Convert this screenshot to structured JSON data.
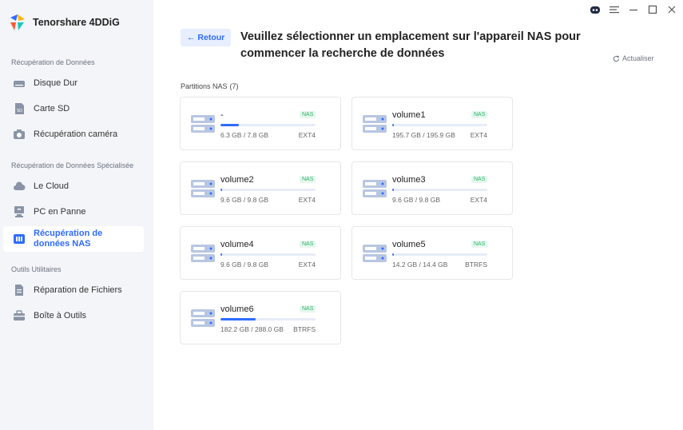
{
  "app": {
    "name": "Tenorshare 4DDiG"
  },
  "sidebar": {
    "sections": [
      {
        "title": "Récupération de Données"
      },
      {
        "title": "Récupération de Données Spécialisée"
      },
      {
        "title": "Outils Utilitaires"
      }
    ],
    "items": [
      {
        "label": "Disque Dur",
        "icon": "hard-drive-icon"
      },
      {
        "label": "Carte SD",
        "icon": "sd-card-icon"
      },
      {
        "label": "Récupération caméra",
        "icon": "camera-icon"
      },
      {
        "label": "Le Cloud",
        "icon": "cloud-icon"
      },
      {
        "label": "PC en Panne",
        "icon": "crashed-pc-icon"
      },
      {
        "label": "Récupération de données NAS",
        "icon": "nas-icon",
        "active": true
      },
      {
        "label": "Réparation de Fichiers",
        "icon": "file-repair-icon"
      },
      {
        "label": "Boîte à Outils",
        "icon": "toolbox-icon"
      }
    ]
  },
  "header": {
    "back_label": "← Retour",
    "title": "Veuillez sélectionner un emplacement sur l'appareil NAS pour commencer la recherche de données",
    "refresh_label": "Actualiser"
  },
  "partitions": {
    "heading": "Partitions NAS",
    "count": "(7)",
    "items": [
      {
        "name": "-",
        "badge": "NAS",
        "size": "6.3 GB / 7.8 GB",
        "fs": "EXT4",
        "used": 0.19
      },
      {
        "name": "volume1",
        "badge": "NAS",
        "size": "195.7 GB / 195.9 GB",
        "fs": "EXT4",
        "used": 0.0
      },
      {
        "name": "volume2",
        "badge": "NAS",
        "size": "9.6 GB / 9.8 GB",
        "fs": "EXT4",
        "used": 0.02
      },
      {
        "name": "volume3",
        "badge": "NAS",
        "size": "9.6 GB / 9.8 GB",
        "fs": "EXT4",
        "used": 0.02
      },
      {
        "name": "volume4",
        "badge": "NAS",
        "size": "9.6 GB / 9.8 GB",
        "fs": "EXT4",
        "used": 0.02
      },
      {
        "name": "volume5",
        "badge": "NAS",
        "size": "14.2 GB / 14.4 GB",
        "fs": "BTRFS",
        "used": 0.02
      },
      {
        "name": "volume6",
        "badge": "NAS",
        "size": "182.2 GB / 288.0 GB",
        "fs": "BTRFS",
        "used": 0.37
      }
    ]
  },
  "colors": {
    "accent": "#2f6bff",
    "badge_green": "#2fb36b",
    "sidebar_bg": "#f3f5f8"
  }
}
